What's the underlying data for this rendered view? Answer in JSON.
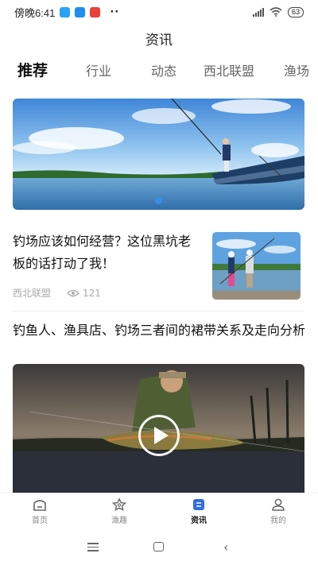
{
  "status_bar": {
    "time": "傍晚6:41",
    "battery": "63",
    "app_icons": [
      "#2aa3f5",
      "#1f8ef0",
      "#e8403a"
    ]
  },
  "header": {
    "title": "资讯"
  },
  "tabs": [
    {
      "label": "推荐",
      "active": true
    },
    {
      "label": "行业",
      "active": false
    },
    {
      "label": "动态",
      "active": false
    },
    {
      "label": "西北联盟",
      "active": false
    },
    {
      "label": "渔场",
      "active": false
    }
  ],
  "banner": {
    "carousel_active_index": 0
  },
  "articles": [
    {
      "title": "钓场应该如何经营？这位黑坑老板的话打动了我！",
      "source": "西北联盟",
      "views": "121"
    },
    {
      "title": "钓鱼人、渔具店、钓场三者间的裙带关系及走向分析"
    }
  ],
  "bottom_nav": [
    {
      "label": "首页",
      "icon": "home-icon",
      "active": false
    },
    {
      "label": "渔趣",
      "icon": "star-icon",
      "active": false
    },
    {
      "label": "资讯",
      "icon": "news-icon",
      "active": true
    },
    {
      "label": "我的",
      "icon": "user-icon",
      "active": false
    }
  ],
  "colors": {
    "accent": "#3a8ee6",
    "active_nav_icon": "#2f6fe0"
  }
}
